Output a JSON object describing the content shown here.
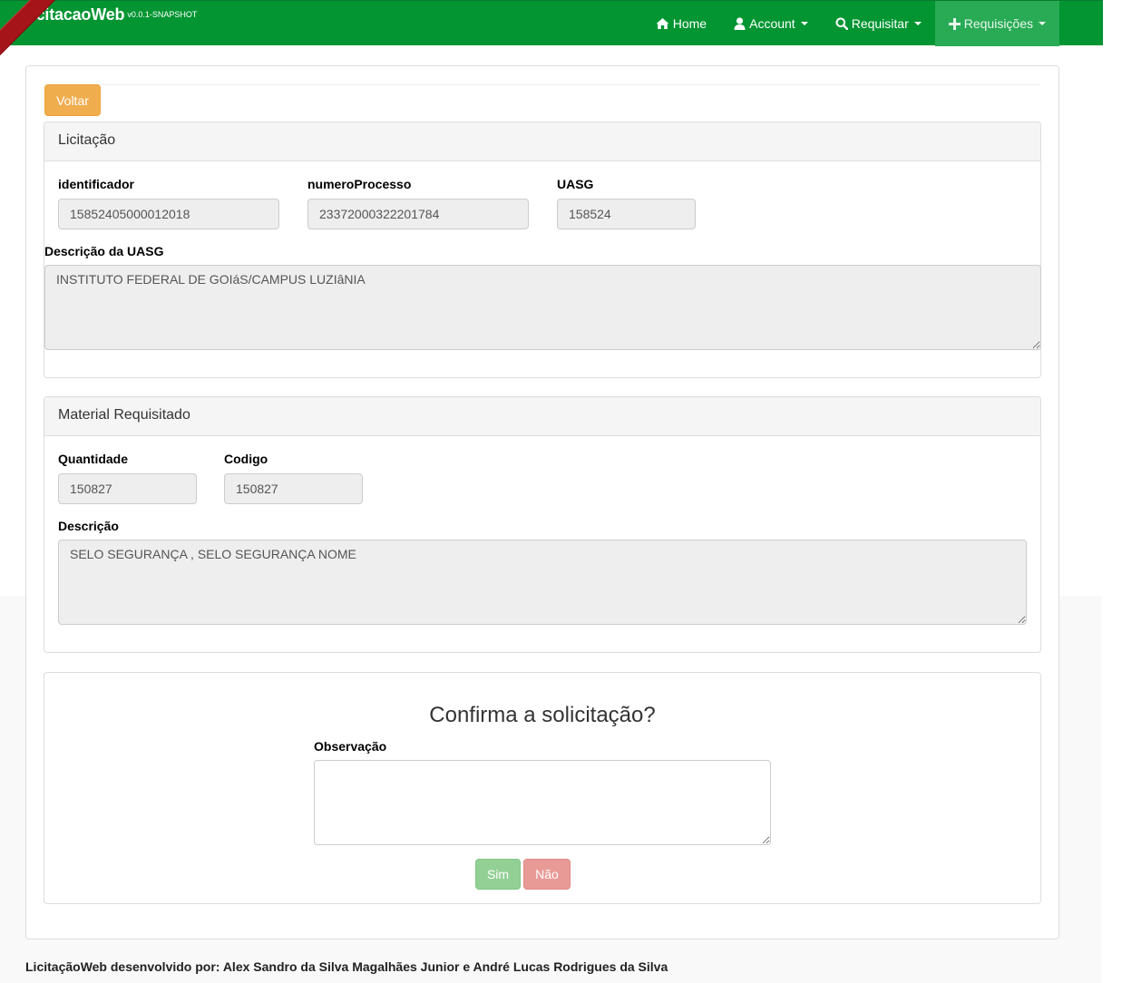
{
  "brand": {
    "name": "LicitacaoWeb",
    "version": "v0.0.1-SNAPSHOT"
  },
  "nav": {
    "home": "Home",
    "account": "Account",
    "requisitar": "Requisitar",
    "requisicoes": "Requisições"
  },
  "voltar_label": "Voltar",
  "licitacao": {
    "title": "Licitação",
    "identificador_label": "identificador",
    "identificador_value": "15852405000012018",
    "numero_processo_label": "numeroProcesso",
    "numero_processo_value": "23372000322201784",
    "uasg_label": "UASG",
    "uasg_value": "158524",
    "descricao_uasg_label": "Descrição da UASG",
    "descricao_uasg_value": "INSTITUTO FEDERAL DE GOIáS/CAMPUS LUZIâNIA"
  },
  "material": {
    "title": "Material Requisitado",
    "quantidade_label": "Quantidade",
    "quantidade_value": "150827",
    "codigo_label": "Codigo",
    "codigo_value": "150827",
    "descricao_label": "Descrição",
    "descricao_value": "SELO SEGURANÇA , SELO SEGURANÇA NOME"
  },
  "confirm": {
    "title": "Confirma a solicitação?",
    "observacao_label": "Observação",
    "observacao_value": "",
    "sim_label": "Sim",
    "nao_label": "Não"
  },
  "footer": "LicitaçãoWeb desenvolvido por: Alex Sandro da Silva Magalhães Junior e André Lucas Rodrigues da Silva",
  "colors": {
    "navbar": "#029532",
    "nav_active": "#29ab56",
    "ribbon": "#a41418",
    "voltar": "#f0ad4e",
    "sim": "#93d095",
    "nao": "#e89a97"
  }
}
